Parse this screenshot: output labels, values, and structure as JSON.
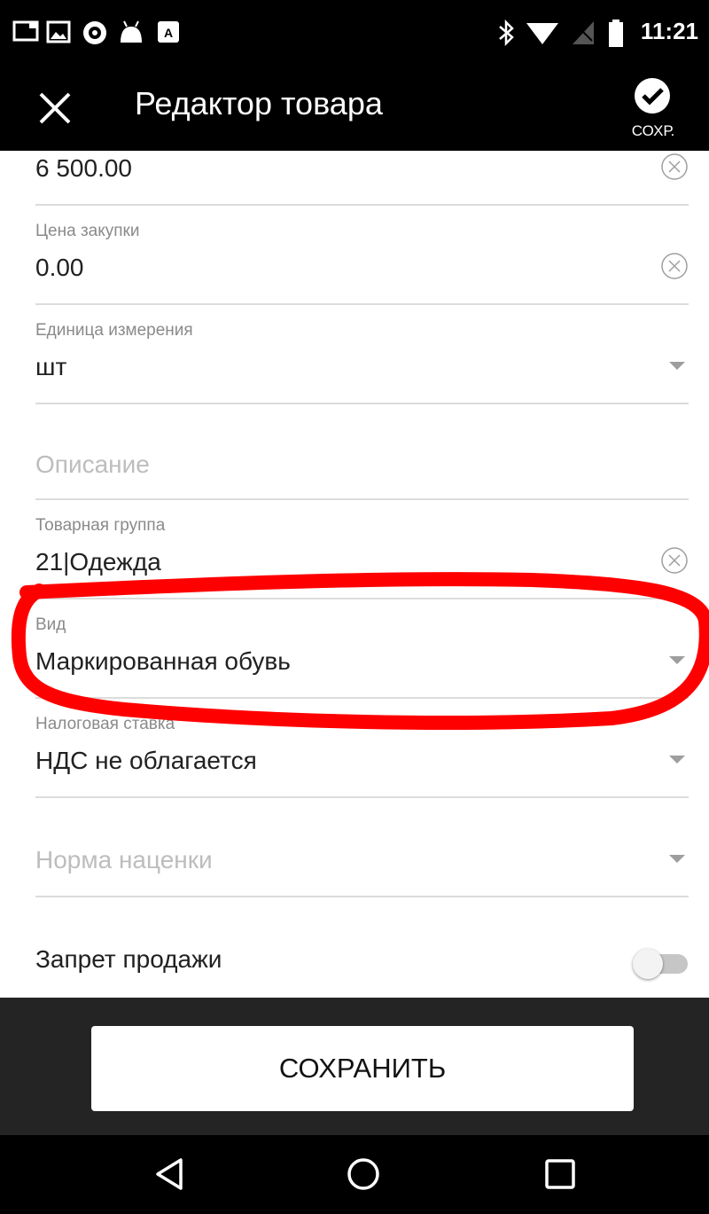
{
  "status_bar": {
    "time": "11:21",
    "left_icons": [
      "cast-icon",
      "image-icon",
      "app-circle-icon",
      "android-icon",
      "keyboard-icon"
    ],
    "right_icons": [
      "bluetooth-icon",
      "wifi-icon",
      "signal-off-icon",
      "battery-icon"
    ]
  },
  "app_bar": {
    "title": "Редактор товара",
    "save_label": "СОХР."
  },
  "fields": {
    "price": {
      "value": "6 500.00"
    },
    "purchase_price": {
      "label": "Цена закупки",
      "value": "0.00"
    },
    "unit": {
      "label": "Единица измерения",
      "value": "шт"
    },
    "description": {
      "placeholder": "Описание"
    },
    "product_group": {
      "label": "Товарная группа",
      "value": "21|Одежда"
    },
    "kind": {
      "label": "Вид",
      "value": "Маркированная обувь"
    },
    "tax_rate": {
      "label": "Налоговая ставка",
      "value": "НДС не облагается"
    },
    "markup": {
      "placeholder": "Норма наценки"
    },
    "sale_ban": {
      "label": "Запрет продажи",
      "enabled": false
    }
  },
  "save_button": {
    "label": "СОХРАНИТЬ"
  },
  "colors": {
    "bar": "#000000",
    "panel": "#242424",
    "annotation": "#ff0000",
    "divider": "#dcdcdc"
  }
}
